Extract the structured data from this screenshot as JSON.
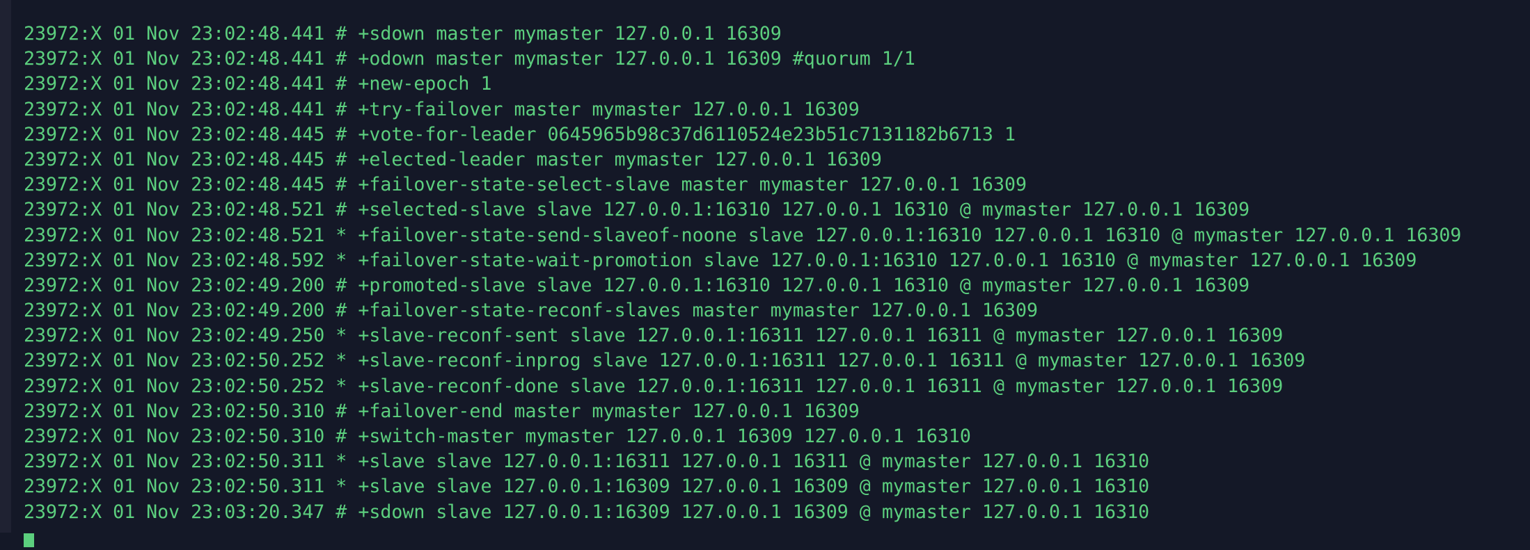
{
  "terminal": {
    "lines": [
      "23972:X 01 Nov 23:02:48.441 # +sdown master mymaster 127.0.0.1 16309",
      "23972:X 01 Nov 23:02:48.441 # +odown master mymaster 127.0.0.1 16309 #quorum 1/1",
      "23972:X 01 Nov 23:02:48.441 # +new-epoch 1",
      "23972:X 01 Nov 23:02:48.441 # +try-failover master mymaster 127.0.0.1 16309",
      "23972:X 01 Nov 23:02:48.445 # +vote-for-leader 0645965b98c37d6110524e23b51c7131182b6713 1",
      "23972:X 01 Nov 23:02:48.445 # +elected-leader master mymaster 127.0.0.1 16309",
      "23972:X 01 Nov 23:02:48.445 # +failover-state-select-slave master mymaster 127.0.0.1 16309",
      "23972:X 01 Nov 23:02:48.521 # +selected-slave slave 127.0.0.1:16310 127.0.0.1 16310 @ mymaster 127.0.0.1 16309",
      "23972:X 01 Nov 23:02:48.521 * +failover-state-send-slaveof-noone slave 127.0.0.1:16310 127.0.0.1 16310 @ mymaster 127.0.0.1 16309",
      "23972:X 01 Nov 23:02:48.592 * +failover-state-wait-promotion slave 127.0.0.1:16310 127.0.0.1 16310 @ mymaster 127.0.0.1 16309",
      "23972:X 01 Nov 23:02:49.200 # +promoted-slave slave 127.0.0.1:16310 127.0.0.1 16310 @ mymaster 127.0.0.1 16309",
      "23972:X 01 Nov 23:02:49.200 # +failover-state-reconf-slaves master mymaster 127.0.0.1 16309",
      "23972:X 01 Nov 23:02:49.250 * +slave-reconf-sent slave 127.0.0.1:16311 127.0.0.1 16311 @ mymaster 127.0.0.1 16309",
      "23972:X 01 Nov 23:02:50.252 * +slave-reconf-inprog slave 127.0.0.1:16311 127.0.0.1 16311 @ mymaster 127.0.0.1 16309",
      "23972:X 01 Nov 23:02:50.252 * +slave-reconf-done slave 127.0.0.1:16311 127.0.0.1 16311 @ mymaster 127.0.0.1 16309",
      "23972:X 01 Nov 23:02:50.310 # +failover-end master mymaster 127.0.0.1 16309",
      "23972:X 01 Nov 23:02:50.310 # +switch-master mymaster 127.0.0.1 16309 127.0.0.1 16310",
      "23972:X 01 Nov 23:02:50.311 * +slave slave 127.0.0.1:16311 127.0.0.1 16311 @ mymaster 127.0.0.1 16310",
      "23972:X 01 Nov 23:02:50.311 * +slave slave 127.0.0.1:16309 127.0.0.1 16309 @ mymaster 127.0.0.1 16310",
      "23972:X 01 Nov 23:03:20.347 # +sdown slave 127.0.0.1:16309 127.0.0.1 16309 @ mymaster 127.0.0.1 16310"
    ]
  },
  "colors": {
    "background": "#141827",
    "text": "#5ccf7e"
  }
}
